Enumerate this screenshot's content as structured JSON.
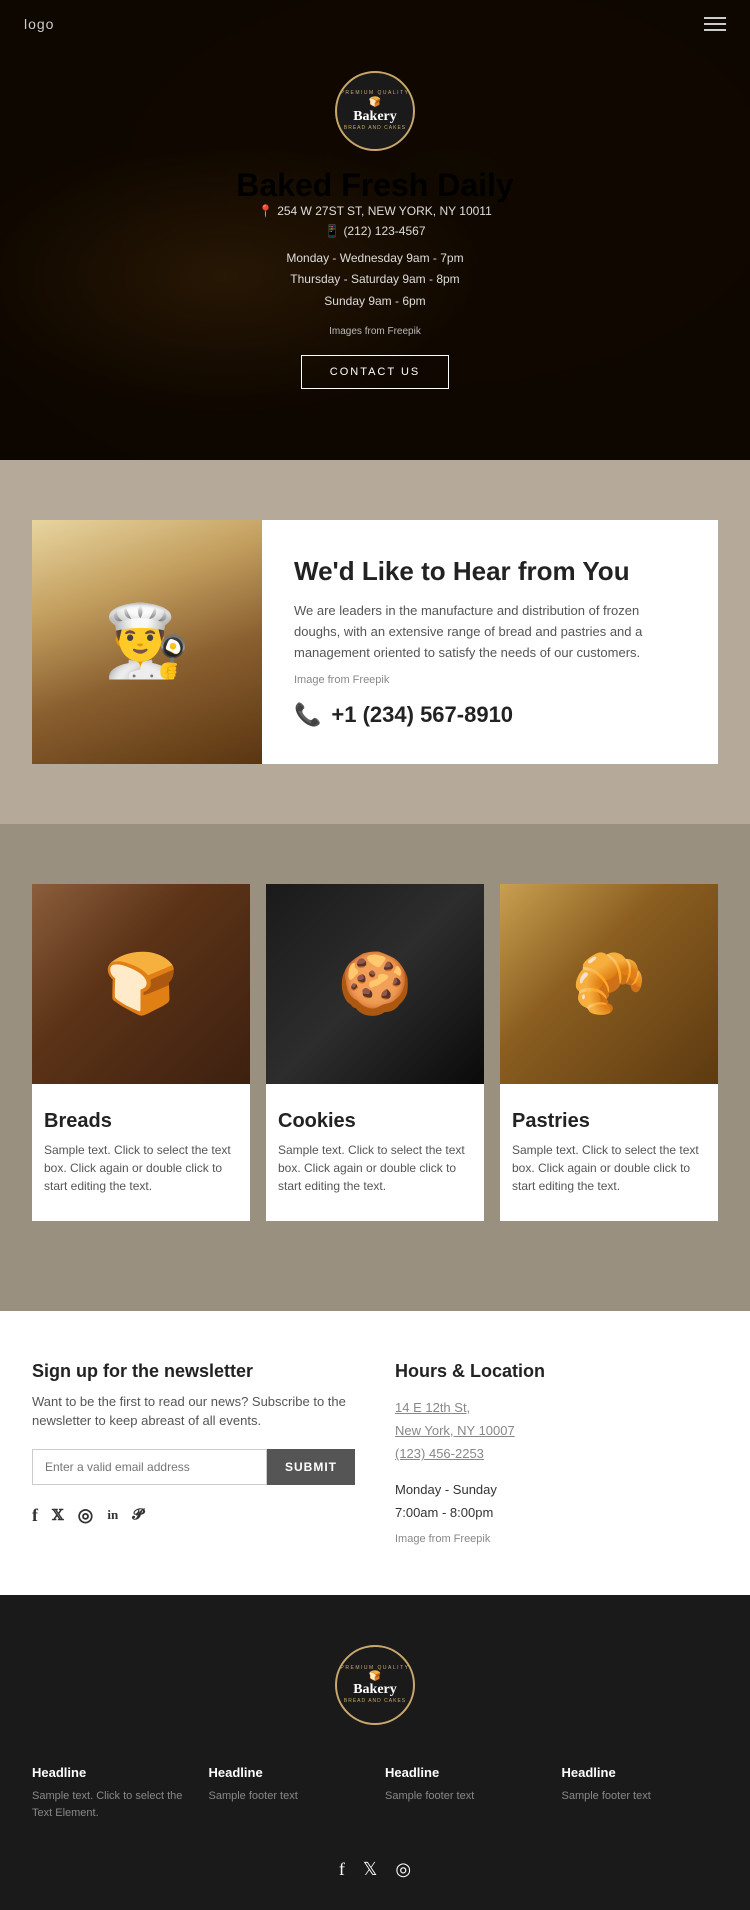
{
  "nav": {
    "logo": "logo",
    "hamburger_label": "menu"
  },
  "hero": {
    "badge": {
      "top_text": "PREMIUM QUALITY",
      "name": "Bakery",
      "sub": "BREAD AND CAKES",
      "icon": "🍞"
    },
    "title": "Baked Fresh Daily",
    "address": "254 W 27ST ST, NEW YORK, NY 10011",
    "phone": "(212) 123-4567",
    "hours_line1": "Monday - Wednesday 9am - 7pm",
    "hours_line2": "Thursday - Saturday 9am - 8pm",
    "hours_line3": "Sunday 9am - 6pm",
    "freepik_text": "Images from Freepik",
    "cta_label": "CONTACT US"
  },
  "contact": {
    "title": "We'd Like to Hear from You",
    "description": "We are leaders in the manufacture and distribution of frozen doughs, with an extensive range of bread and pastries and a management oriented to satisfy the needs of our customers.",
    "freepik_text": "Image from Freepik",
    "phone": "+1 (234) 567-8910"
  },
  "products": {
    "items": [
      {
        "name": "Breads",
        "emoji": "🍞",
        "description": "Sample text. Click to select the text box. Click again or double click to start editing the text."
      },
      {
        "name": "Cookies",
        "emoji": "🍪",
        "description": "Sample text. Click to select the text box. Click again or double click to start editing the text."
      },
      {
        "name": "Pastries",
        "emoji": "🥐",
        "description": "Sample text. Click to select the text box. Click again or double click to start editing the text."
      }
    ]
  },
  "newsletter": {
    "title": "Sign up for the newsletter",
    "description": "Want to be the first to read our news? Subscribe to the newsletter to keep abreast of all events.",
    "input_placeholder": "Enter a valid email address",
    "submit_label": "SUBMIT",
    "social": [
      "f",
      "𝕏",
      "◎",
      "in",
      "𝓟"
    ]
  },
  "hours": {
    "title": "Hours & Location",
    "address_line1": "14 E 12th St,",
    "address_line2": "New York, NY 10007",
    "phone": "(123) 456-2253",
    "schedule": "Monday - Sunday",
    "hours": "7:00am - 8:00pm",
    "freepik_text": "Image from Freepik"
  },
  "footer": {
    "badge": {
      "top_text": "PREMIUM QUALITY",
      "name": "Bakery",
      "sub": "BREAD AND CAKES"
    },
    "columns": [
      {
        "headline": "Headline",
        "text": "Sample text. Click to select the Text Element."
      },
      {
        "headline": "Headline",
        "text": "Sample footer text"
      },
      {
        "headline": "Headline",
        "text": "Sample footer text"
      },
      {
        "headline": "Headline",
        "text": "Sample footer text"
      }
    ],
    "social": [
      "f",
      "𝕏",
      "◎"
    ]
  }
}
